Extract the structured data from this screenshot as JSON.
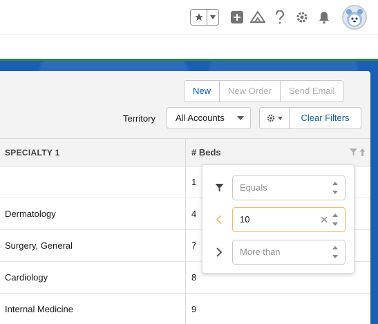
{
  "header": {
    "icons": [
      "star-icon",
      "chevron-down-icon",
      "plus-icon",
      "trailhead-icon",
      "help-icon",
      "settings-icon",
      "bell-icon",
      "avatar"
    ]
  },
  "toolbar": {
    "buttons": [
      {
        "label": "New",
        "enabled": true
      },
      {
        "label": "New Order",
        "enabled": false
      },
      {
        "label": "Send Email",
        "enabled": false
      }
    ],
    "territory_label": "Territory",
    "territory_value": "All Accounts",
    "clear_filters_label": "Clear Filters"
  },
  "table": {
    "columns": [
      "SPECIALTY 1",
      "# Beds"
    ],
    "rows": [
      {
        "specialty": "",
        "beds": "1"
      },
      {
        "specialty": "Dermatology",
        "beds": "4"
      },
      {
        "specialty": "Surgery, General",
        "beds": "7"
      },
      {
        "specialty": "Cardiology",
        "beds": "8"
      },
      {
        "specialty": "Internal Medicine",
        "beds": "9"
      }
    ]
  },
  "filter_popover": {
    "equals_placeholder": "Equals",
    "less_than_value": "10",
    "more_than_placeholder": "More than"
  },
  "colors": {
    "brand_blue": "#1b5fb4",
    "link_blue": "#0b5cab",
    "accent_green": "#2e844a",
    "focus_orange": "#f4b76a"
  }
}
